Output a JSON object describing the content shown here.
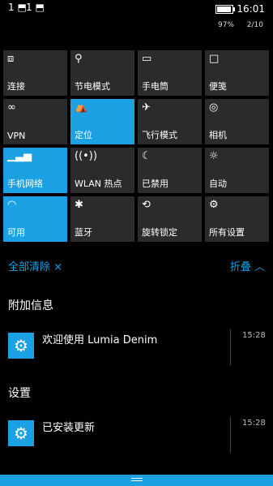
{
  "status": {
    "left_icons": [
      "1 ⬒",
      "1 ⬒"
    ],
    "time": "16:01",
    "battery_percent": "97%",
    "page": "2/10"
  },
  "tiles": [
    {
      "label": "连接",
      "icon": "⧈",
      "on": false
    },
    {
      "label": "节电模式",
      "icon": "⚲",
      "on": false
    },
    {
      "label": "手电筒",
      "icon": "▭",
      "on": false
    },
    {
      "label": "便笺",
      "icon": "□",
      "on": false
    },
    {
      "label": "VPN",
      "icon": "∞",
      "on": false
    },
    {
      "label": "定位",
      "icon": "⛺",
      "on": true
    },
    {
      "label": "飞行模式",
      "icon": "✈",
      "on": false
    },
    {
      "label": "相机",
      "icon": "◎",
      "on": false
    },
    {
      "label": "手机网络",
      "icon": "▁▃▅",
      "on": true
    },
    {
      "label": "WLAN 热点",
      "icon": "((•))",
      "on": false
    },
    {
      "label": "已禁用",
      "icon": "☾",
      "on": false
    },
    {
      "label": "自动",
      "icon": "☼",
      "on": false
    },
    {
      "label": "可用",
      "icon": "◠",
      "on": true
    },
    {
      "label": "蓝牙",
      "icon": "✱",
      "on": false
    },
    {
      "label": "旋转锁定",
      "icon": "⟲",
      "on": false
    },
    {
      "label": "所有设置",
      "icon": "⚙",
      "on": false
    }
  ],
  "actions": {
    "clear_all": "全部清除 ×",
    "collapse": "折叠 ︿"
  },
  "sections": [
    {
      "title": "附加信息",
      "notification": {
        "text": "欢迎使用 Lumia Denim",
        "time": "15:28",
        "icon": "gear-icon"
      }
    },
    {
      "title": "设置",
      "notification": {
        "text": "已安装更新",
        "time": "15:28",
        "icon": "gear-icon"
      }
    }
  ],
  "colors": {
    "accent": "#1ba1e2",
    "tile": "#2b2b2b"
  }
}
